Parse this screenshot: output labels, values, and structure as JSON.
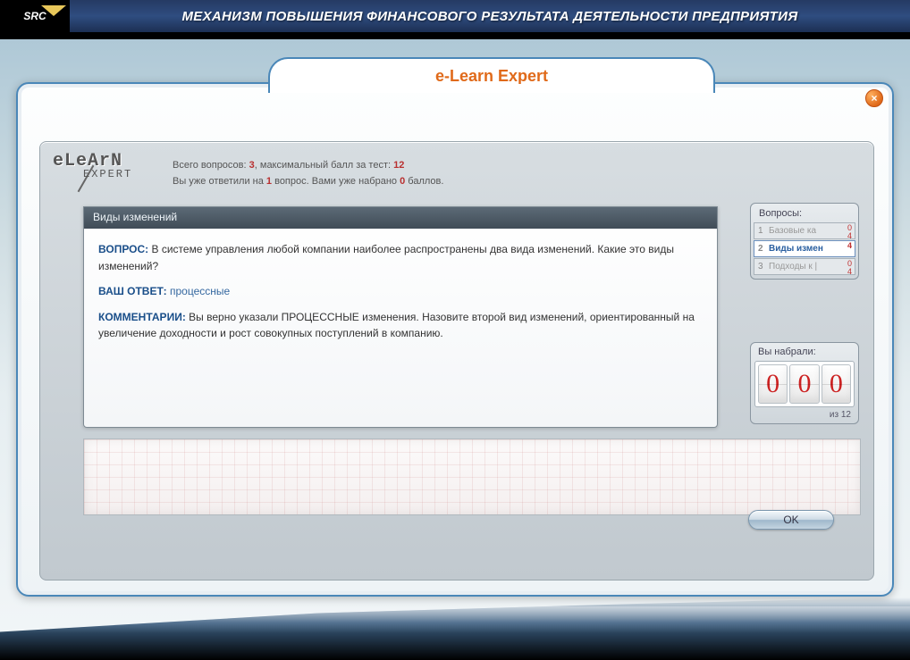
{
  "header": {
    "brand": "SRC",
    "title": "МЕХАНИЗМ ПОВЫШЕНИЯ ФИНАНСОВОГО РЕЗУЛЬТАТА ДЕЯТЕЛЬНОСТИ ПРЕДПРИЯТИЯ"
  },
  "app_title": "e-Learn Expert",
  "stats": {
    "total_label": "Всего вопросов:",
    "total_value": "3",
    "mid_label": ", максимальный балл за тест:",
    "max_score": "12",
    "answered_prefix": "Вы уже ответили на",
    "answered_value": "1",
    "answered_suffix": "вопрос. Вами уже набрано",
    "scored_value": "0",
    "scored_suffix": "баллов."
  },
  "question_panel": {
    "header": "Виды изменений",
    "q_label": "ВОПРОС:",
    "q_text": "В системе управления любой компании наиболее распространены два вида изменений. Какие это виды изменений?",
    "a_label": "ВАШ ОТВЕТ:",
    "a_text": "процессные",
    "c_label": "КОММЕНТАРИИ:",
    "c_text": "Вы верно указали ПРОЦЕССНЫЕ изменения. Назовите второй вид изменений, ориентированный на увеличение доходности и рост совокупных поступлений в компанию."
  },
  "sidebar": {
    "title": "Вопросы:",
    "items": [
      {
        "n": "1",
        "label": "Базовые ка",
        "score_top": "0",
        "score_bot": "4"
      },
      {
        "n": "2",
        "label": "Виды измен",
        "score_top": "",
        "score_bot": "4"
      },
      {
        "n": "3",
        "label": "Подходы к |",
        "score_top": "0",
        "score_bot": "4"
      }
    ]
  },
  "score": {
    "title": "Вы набрали:",
    "digits": [
      "0",
      "0",
      "0"
    ],
    "footer": "из 12"
  },
  "buttons": {
    "ok": "OK",
    "close": "×"
  }
}
